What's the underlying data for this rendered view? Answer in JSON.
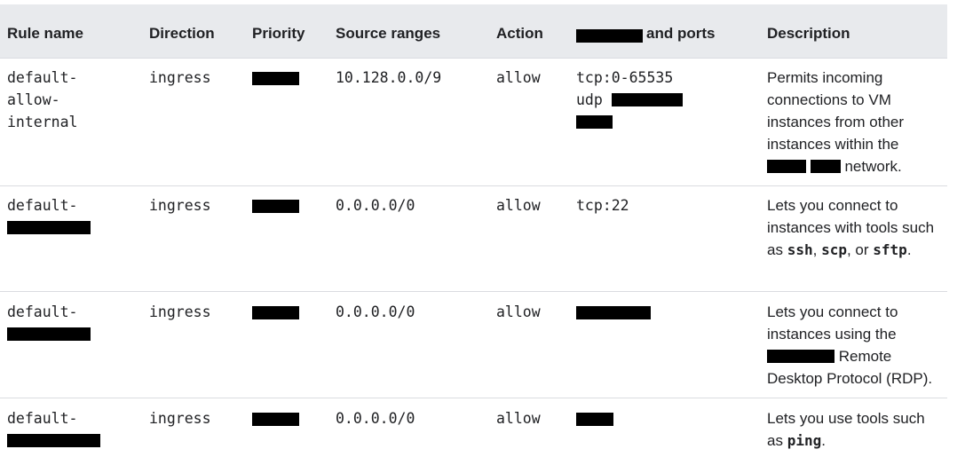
{
  "columns": {
    "rule_name": "Rule name",
    "direction": "Direction",
    "priority": "Priority",
    "source_ranges": "Source ranges",
    "action": "Action",
    "ports_suffix": "and ports",
    "description": "Description"
  },
  "rows": [
    {
      "name_line1": "default-",
      "name_line2": "allow-",
      "name_line3": "internal",
      "direction": "ingress",
      "source": "10.128.0.0/9",
      "action": "allow",
      "port_line1": "tcp:0-65535",
      "port_line2": "udp",
      "description": {
        "t1": "Permits incoming connections to VM instances from other instances within the",
        "t2": "network."
      }
    },
    {
      "name_line1": "default-",
      "direction": "ingress",
      "source": "0.0.0.0/0",
      "action": "allow",
      "port_line1": "tcp:22",
      "description": {
        "t1": "Lets you connect to instances with tools such as",
        "c1": "ssh",
        "t2": ",",
        "c2": "scp",
        "t3": ", or",
        "c3": "sftp",
        "t4": "."
      }
    },
    {
      "name_line1": "default-",
      "direction": "ingress",
      "source": "0.0.0.0/0",
      "action": "allow",
      "description": {
        "t1": "Lets you connect to instances using the",
        "t2": "Remote Desktop Protocol (RDP)."
      }
    },
    {
      "name_line1": "default-",
      "direction": "ingress",
      "source": "0.0.0.0/0",
      "action": "allow",
      "description": {
        "t1": "Lets you use tools such as",
        "c1": "ping",
        "t2": "."
      }
    }
  ]
}
